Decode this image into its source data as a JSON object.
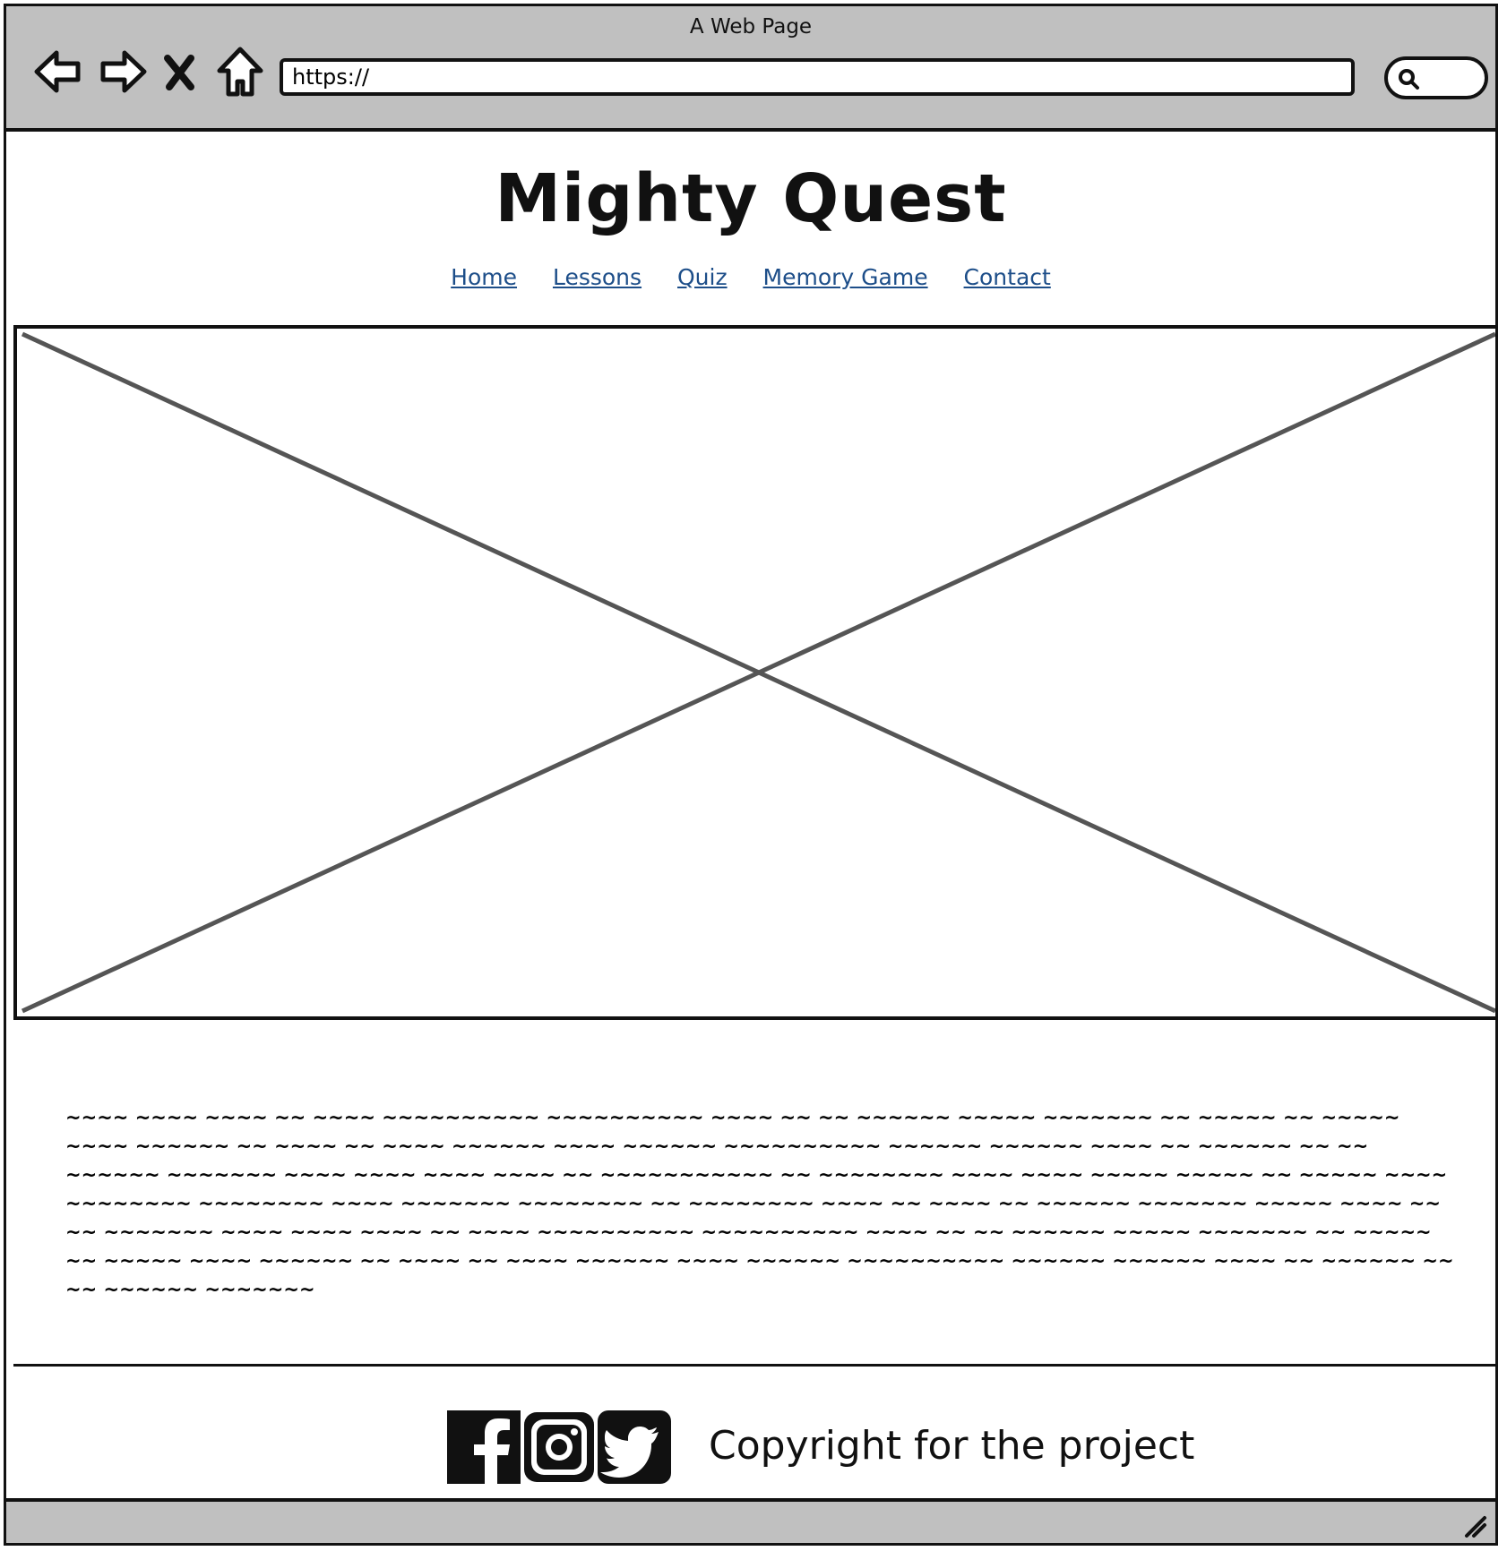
{
  "window": {
    "title": "A Web Page"
  },
  "browser": {
    "url": "https://",
    "buttons": [
      "back-arrow-icon",
      "forward-arrow-icon",
      "close-x-icon",
      "home-icon"
    ],
    "search_icon": "search-icon"
  },
  "site": {
    "title": "Mighty Quest",
    "nav": [
      {
        "label": "Home"
      },
      {
        "label": "Lessons"
      },
      {
        "label": "Quiz"
      },
      {
        "label": "Memory Game"
      },
      {
        "label": "Contact"
      }
    ]
  },
  "hero": {
    "placeholder": "image-placeholder"
  },
  "content": {
    "paragraph": "~~~~ ~~~~ ~~~~ ~~ ~~~~ ~~~~~~~~~~ ~~~~~~~~~~ ~~~~ ~~ ~~ ~~~~~~ ~~~~~ ~~~~~~~ ~~ ~~~~~ ~~ ~~~~~ ~~~~ ~~~~~~ ~~ ~~~~ ~~ ~~~~ ~~~~~~ ~~~~ ~~~~~~ ~~~~~~~~~~ ~~~~~~ ~~~~~~ ~~~~ ~~ ~~~~~~ ~~ ~~ ~~~~~~ ~~~~~~~ ~~~~ ~~~~ ~~~~ ~~~~ ~~ ~~~~~~~~~~~ ~~ ~~~~~~~~ ~~~~ ~~~~ ~~~~~ ~~~~~ ~~ ~~~~~ ~~~~ ~~~~~~~~ ~~~~~~~~ ~~~~ ~~~~~~~ ~~~~~~~~ ~~ ~~~~~~~~ ~~~~ ~~ ~~~~ ~~ ~~~~~~ ~~~~~~~ ~~~~~ ~~~~ ~~ ~~ ~~~~~~~ ~~~~ ~~~~ ~~~~ ~~ ~~~~ ~~~~~~~~~~ ~~~~~~~~~~ ~~~~ ~~ ~~ ~~~~~~ ~~~~~ ~~~~~~~ ~~ ~~~~~ ~~ ~~~~~ ~~~~ ~~~~~~ ~~ ~~~~ ~~ ~~~~ ~~~~~~ ~~~~ ~~~~~~ ~~~~~~~~~~ ~~~~~~ ~~~~~~ ~~~~ ~~ ~~~~~~ ~~ ~~ ~~~~~~ ~~~~~~~"
  },
  "footer": {
    "social": [
      "facebook-icon",
      "instagram-icon",
      "twitter-icon"
    ],
    "copyright": "Copyright  for the project"
  },
  "colors": {
    "chrome": "#c0c0c0",
    "link": "#1d4e89",
    "outline": "#111111"
  }
}
